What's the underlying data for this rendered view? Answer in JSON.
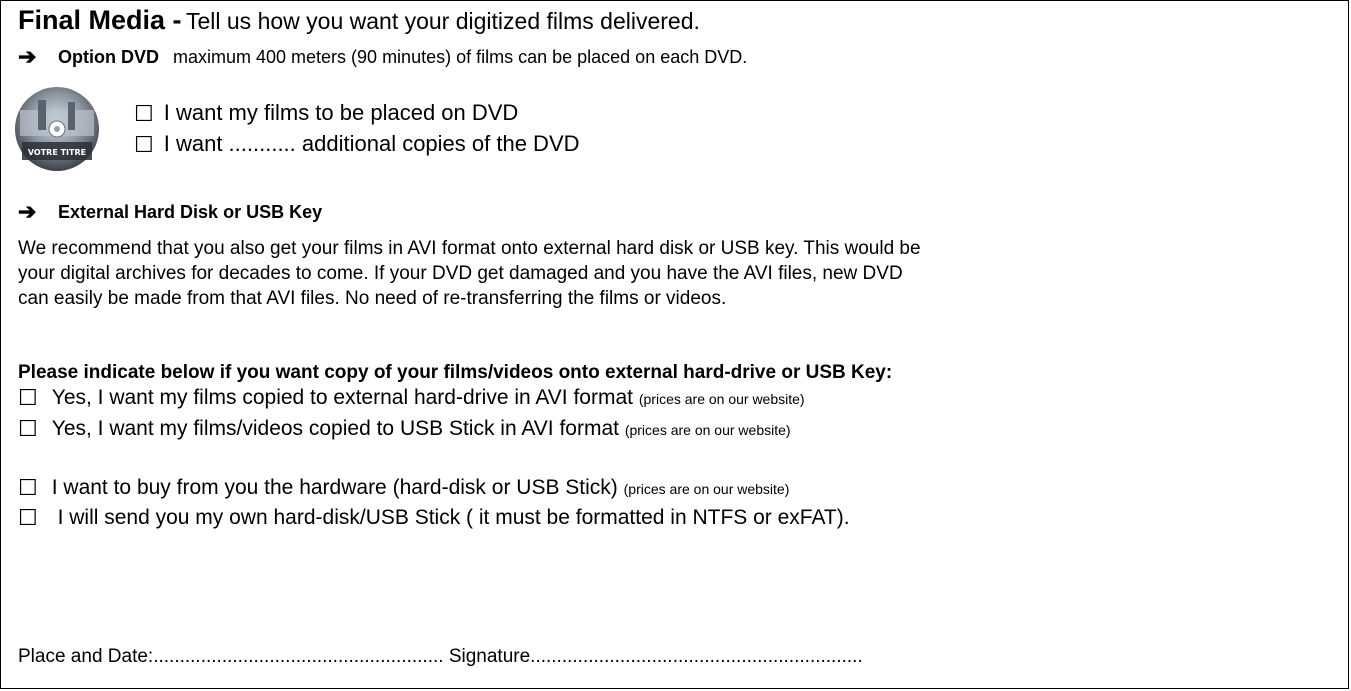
{
  "header": {
    "title_bold": "Final Media -",
    "title_rest": "Tell us how you want your digitized films delivered."
  },
  "dvd_section": {
    "label": "Option DVD",
    "description": "maximum 400 meters (90 minutes) of films can be placed on each DVD.",
    "disc_text": "VOTRE TITRE",
    "options": [
      "I want my films to be placed on DVD",
      "I want ...........  additional copies of the DVD"
    ]
  },
  "hdd_section": {
    "label": "External Hard Disk or USB Key",
    "paragraph_lines": [
      "We recommend that you also get your films in AVI format onto external hard disk or USB key. This would be",
      "your digital archives for decades to come. If your DVD get damaged and you have the AVI files, new DVD",
      "can easily be made from that AVI files. No need of re-transferring the films or videos."
    ],
    "question": "Please indicate below if you want copy of your films/videos onto external hard-drive or USB Key:",
    "options": [
      {
        "text": "Yes, I want my films copied to external hard-drive in AVI format",
        "note": "(prices are on our website)"
      },
      {
        "text": "Yes, I want my films/videos copied to USB Stick in AVI format",
        "note": "(prices are on our website)"
      },
      {
        "text": "I want to buy from you the hardware (hard-disk or USB Stick)",
        "note": "(prices are on our website)"
      },
      {
        "text": " I will send you my own hard-disk/USB Stick ( it must be formatted in NTFS or exFAT).",
        "note": ""
      }
    ]
  },
  "footer": {
    "place_date": "Place and Date:.......................................................",
    "signature": "Signature..............................................................."
  },
  "icons": {
    "arrow": "right-arrow-icon",
    "checkbox": "checkbox-icon",
    "disc": "dvd-disc-icon"
  },
  "checkbox_glyph": "☐",
  "arrow_glyph": "➔"
}
